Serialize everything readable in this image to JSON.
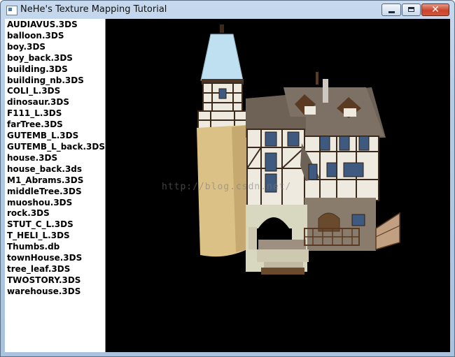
{
  "window": {
    "title": "NeHe's Texture Mapping Tutorial",
    "close_glyph": "✕"
  },
  "file_list": [
    "AUDIAVUS.3DS",
    "balloon.3DS",
    "boy.3DS",
    "boy_back.3DS",
    "building.3DS",
    "building_nb.3DS",
    "COLI_L.3DS",
    "dinosaur.3DS",
    "F111_L.3DS",
    "farTree.3DS",
    "GUTEMB_L.3DS",
    "GUTEMB_L_back.3DS",
    "house.3DS",
    "house_back.3ds",
    "M1_Abrams.3DS",
    "middleTree.3DS",
    "muoshou.3DS",
    "rock.3DS",
    "STUT_C_L.3DS",
    "T_HELI_L.3DS",
    "Thumbs.db",
    "townHouse.3DS",
    "tree_leaf.3DS",
    "TWOSTORY.3DS",
    "warehouse.3DS"
  ],
  "viewport": {
    "watermark": "http://blog.csdn.net/"
  },
  "colors": {
    "viewport_bg": "#000000",
    "tower_body": "#dcc187",
    "spire": "#bfe0f0",
    "timber": "#3b2a1c",
    "plaster": "#efeae0",
    "roof": "#6e6257",
    "stone": "#d8d8c0"
  }
}
